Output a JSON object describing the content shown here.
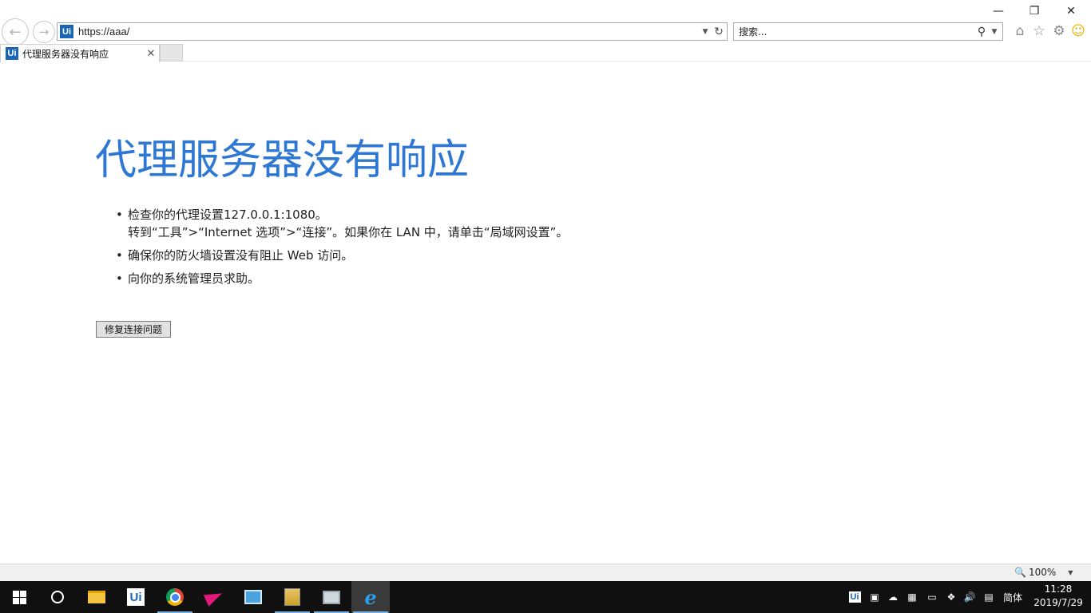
{
  "window": {
    "minimize_glyph": "—",
    "restore_glyph": "❐",
    "close_glyph": "✕"
  },
  "toolbar": {
    "address": "https://aaa/",
    "search_placeholder": "搜索...",
    "site_icon_text": "Ui"
  },
  "tabs": [
    {
      "label": "代理服务器没有响应",
      "icon_text": "Ui"
    }
  ],
  "page": {
    "headline": "代理服务器没有响应",
    "tips": [
      {
        "line1": "检查你的代理设置127.0.0.1:1080。",
        "line2": "转到“工具”>“Internet 选项”>“连接”。如果你在 LAN 中，请单击“局域网设置”。"
      },
      {
        "line1": "确保你的防火墙设置没有阻止 Web 访问。"
      },
      {
        "line1": "向你的系统管理员求助。"
      }
    ],
    "fix_button": "修复连接问题"
  },
  "statusbar": {
    "zoom": "100%"
  },
  "taskbar": {
    "pinned": [
      "start-icon",
      "cortana-icon",
      "file-explorer-icon",
      "uipath-icon",
      "chrome-icon",
      "send-app-icon",
      "app-box-icon",
      "server-icon",
      "monitor-icon",
      "internet-explorer-icon"
    ],
    "tray_ui": "Ui",
    "ime": "简体",
    "time": "11:28",
    "date": "2019/7/29"
  },
  "colors": {
    "headline": "#2e78d4",
    "taskbar": "#101010",
    "accent": "#1a65b6"
  }
}
